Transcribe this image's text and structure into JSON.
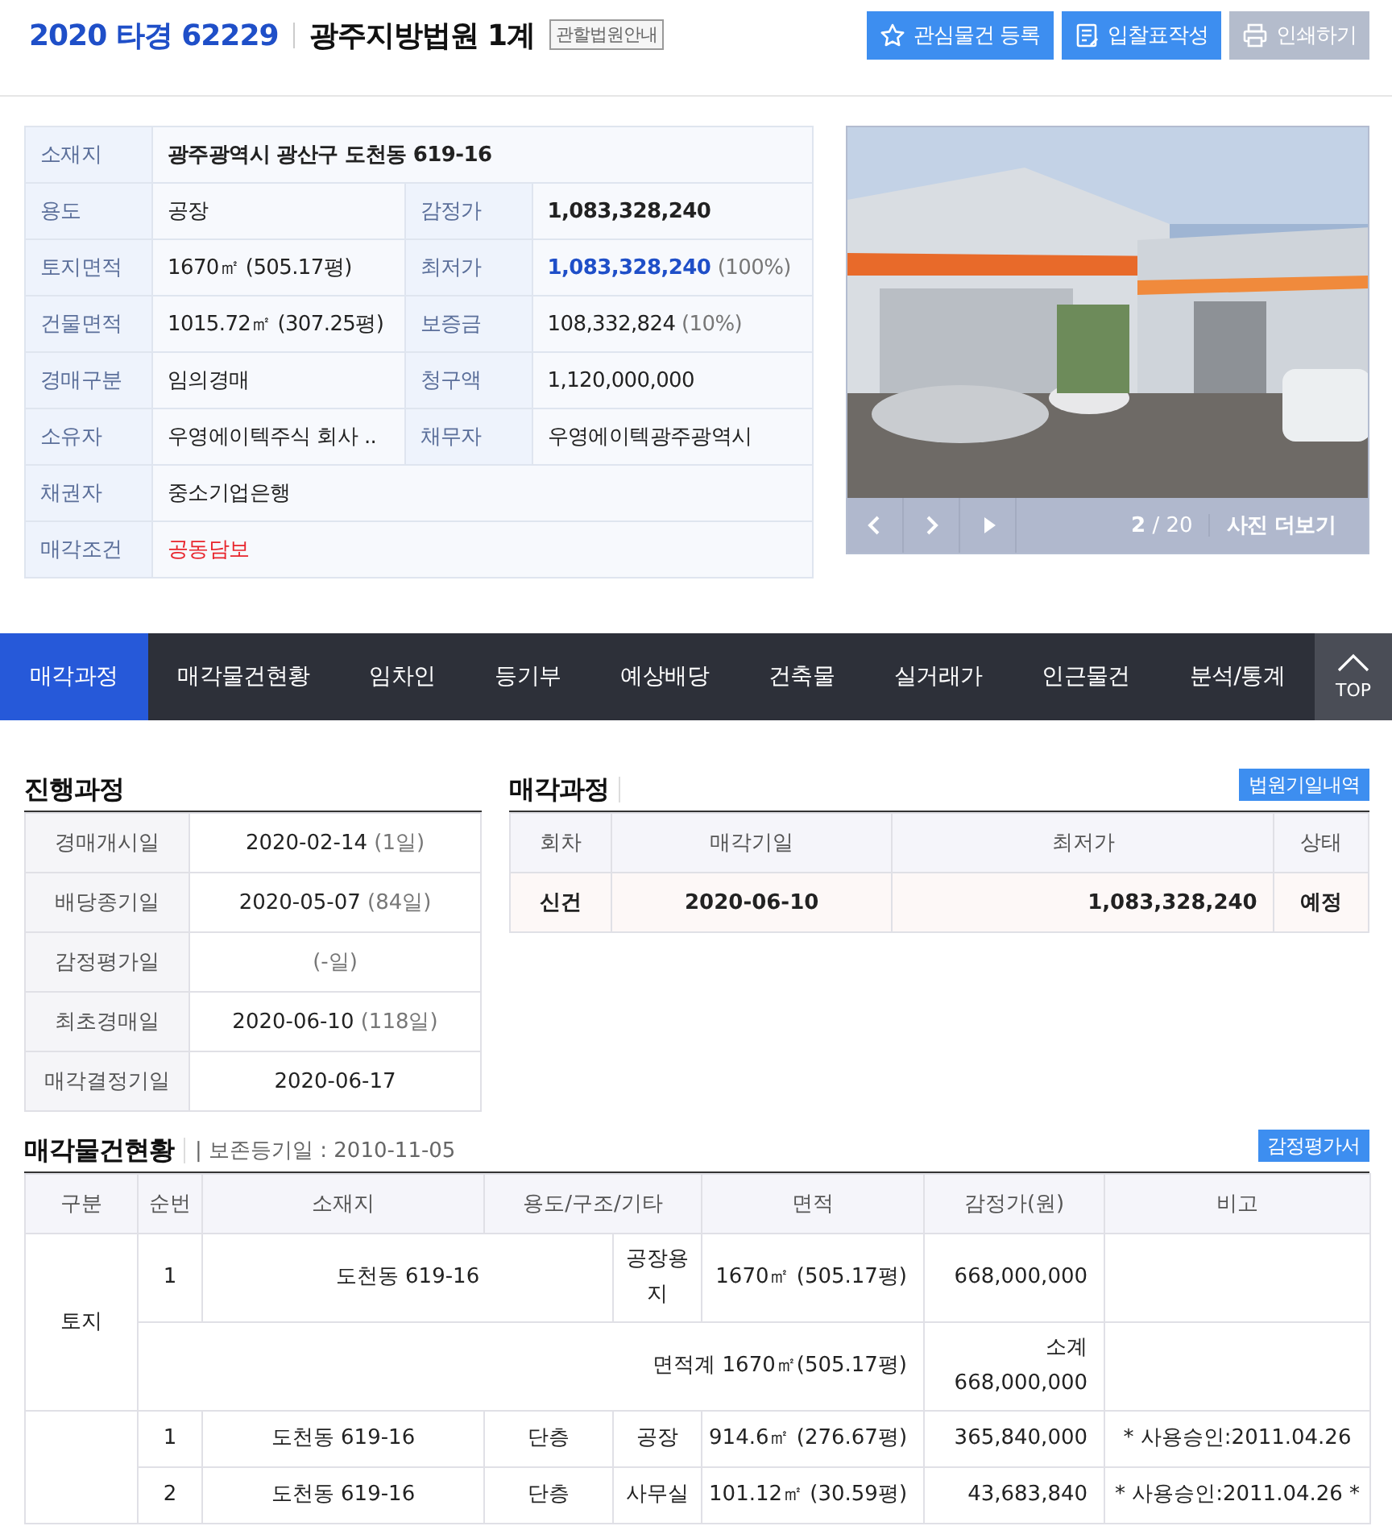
{
  "header": {
    "case_number": "2020 타경 62229",
    "court": "광주지방법원 1계",
    "court_info": "관할법원안내",
    "buttons": [
      {
        "label": "관심물건 등록",
        "kind": "star",
        "disabled": false
      },
      {
        "label": "입찰표작성",
        "kind": "form",
        "disabled": false
      },
      {
        "label": "인쇄하기",
        "kind": "print",
        "disabled": true
      }
    ]
  },
  "info_table": [
    [
      {
        "label": "소재지",
        "value": "광주광역시 광산구 도천동 619-16",
        "bold": true
      }
    ],
    [
      {
        "label": "용도",
        "value": "공장"
      },
      {
        "label": "감정가",
        "value": "1,083,328,240",
        "bold": true
      }
    ],
    [
      {
        "label": "토지면적",
        "value": "1670㎡ (505.17평)"
      },
      {
        "label": "최저가",
        "value": "1,083,328,240",
        "accent": true,
        "note": "(100%)"
      }
    ],
    [
      {
        "label": "건물면적",
        "value": "1015.72㎡ (307.25평)"
      },
      {
        "label": "보증금",
        "value": "108,332,824",
        "note": "(10%)"
      }
    ],
    [
      {
        "label": "경매구분",
        "value": "임의경매"
      },
      {
        "label": "청구액",
        "value": "1,120,000,000"
      }
    ],
    [
      {
        "label": "소유자",
        "value": "우영에이텍주식 회사 .."
      },
      {
        "label": "채무자",
        "value": "우영에이텍광주광역시"
      }
    ],
    [
      {
        "label": "채권자",
        "value": "중소기업은행"
      }
    ],
    [
      {
        "label": "매각조건",
        "value": "공동담보",
        "alert": true
      }
    ]
  ],
  "photo": {
    "kind": "picture",
    "counter": "**2** / 20",
    "more": "사진 더보기"
  },
  "tabs": [
    {
      "label": "매각과정",
      "selected": true
    },
    {
      "label": "매각물건현황",
      "selected": false
    },
    {
      "label": "임차인",
      "selected": false
    },
    {
      "label": "등기부",
      "selected": false
    },
    {
      "label": "예상배당",
      "selected": false
    },
    {
      "label": "건축물",
      "selected": false
    },
    {
      "label": "실거래가",
      "selected": false
    },
    {
      "label": "인근물건",
      "selected": false
    },
    {
      "label": "분석/통계",
      "selected": false
    }
  ],
  "top_button": "TOP",
  "progress": {
    "title": "진행과정",
    "rows": [
      {
        "label": "경매개시일",
        "date": "2020-02-14",
        "note": "(1일)"
      },
      {
        "label": "배당종기일",
        "date": "2020-05-07",
        "note": "(84일)"
      },
      {
        "label": "감정평가일",
        "note": "(-일)"
      },
      {
        "label": "최초경매일",
        "date": "2020-06-10",
        "note": "(118일)"
      },
      {
        "label": "매각결정기일",
        "date": "2020-06-17"
      }
    ]
  },
  "sale": {
    "title": "매각과정",
    "button": "법원기일내역",
    "columns": [
      "회차",
      "매각기일",
      "최저가",
      "상태"
    ],
    "rows": [
      {
        "round": "신건",
        "date": "2020-06-10",
        "min_price": "1,083,328,240",
        "status": "예정"
      }
    ]
  },
  "items": {
    "title": "매각물건현황",
    "subtitle": "| 보존등기일 : 2010-11-05",
    "button": "감정평가서",
    "columns": [
      "구분",
      "순번",
      "소재지",
      "용도/구조/기타",
      "면적",
      "감정가(원)",
      "비고"
    ],
    "groups": [
      {
        "category": "토지",
        "rows": [
          {
            "no": "1",
            "address": "도천동 619-16",
            "usage": "공장용지",
            "area": "1670㎡ (505.17평)",
            "price": "668,000,000"
          }
        ],
        "subtotal": {
          "area": "면적계 1670㎡(505.17평)",
          "label": "소계",
          "amount": "668,000,000"
        }
      },
      {
        "rows": [
          {
            "no": "1",
            "address": "도천동 619-16",
            "structure": "단층",
            "usage": "공장",
            "area": "914.6㎡ (276.67평)",
            "price": "365,840,000",
            "note": "* 사용승인:2011.04.26"
          },
          {
            "no": "2",
            "address": "도천동 619-16",
            "structure": "단층",
            "usage": "사무실",
            "area": "101.12㎡ (30.59평)",
            "price": "43,683,840",
            "note": "* 사용승인:2011.04.26 *"
          }
        ]
      }
    ]
  }
}
